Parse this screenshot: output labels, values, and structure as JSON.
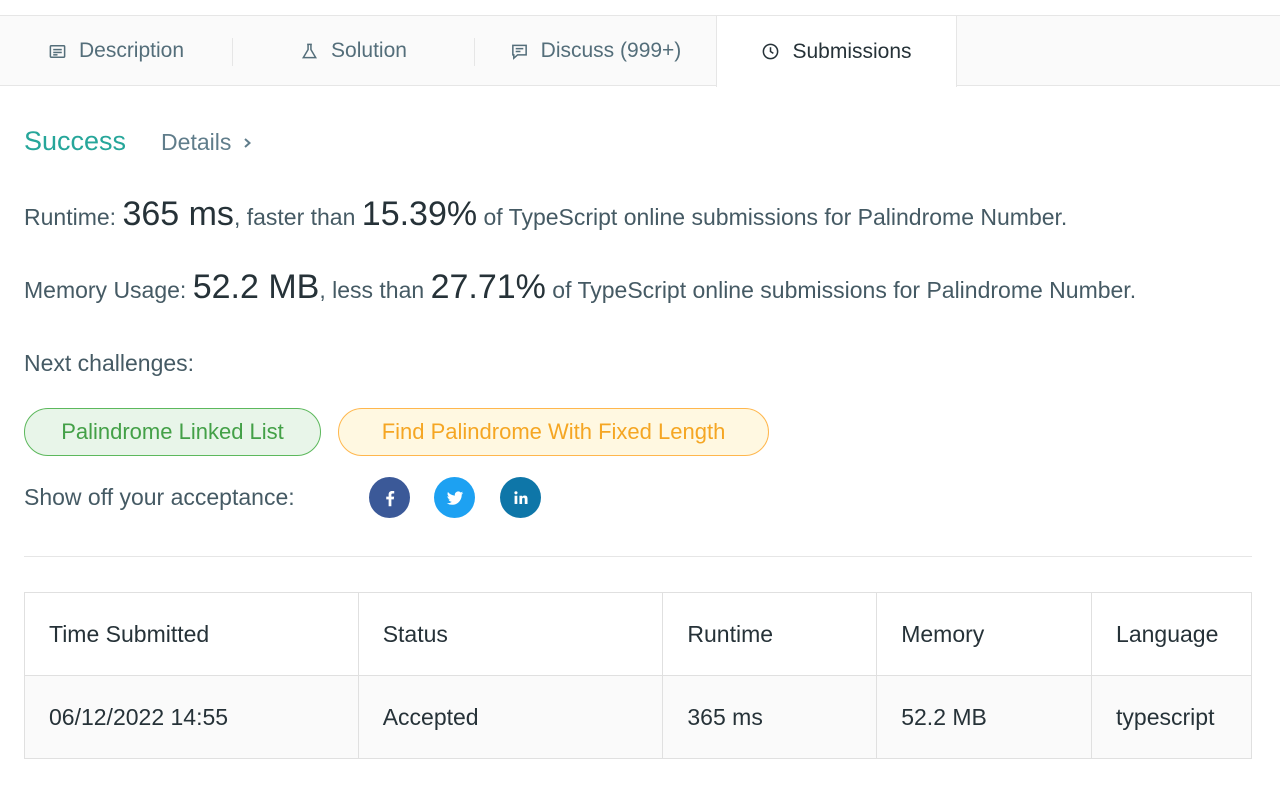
{
  "tabs": [
    {
      "label": "Description",
      "icon": "description-icon"
    },
    {
      "label": "Solution",
      "icon": "flask-icon"
    },
    {
      "label": "Discuss (999+)",
      "icon": "comment-icon"
    },
    {
      "label": "Submissions",
      "icon": "clock-icon",
      "active": true
    }
  ],
  "result": {
    "status": "Success",
    "details_label": "Details"
  },
  "runtime": {
    "label": "Runtime:",
    "value": "365 ms",
    "comparison": ", faster than",
    "percent": "15.39%",
    "suffix": "of TypeScript online submissions for Palindrome Number."
  },
  "memory": {
    "label": "Memory Usage:",
    "value": "52.2 MB",
    "comparison": ", less than",
    "percent": "27.71%",
    "suffix": "of TypeScript online submissions for Palindrome Number."
  },
  "next_challenges": {
    "label": "Next challenges:",
    "items": [
      {
        "label": "Palindrome Linked List",
        "color": "#43a047"
      },
      {
        "label": "Find Palindrome With Fixed Length",
        "color": "#f5a623"
      }
    ]
  },
  "share": {
    "label": "Show off your acceptance:",
    "icons": [
      "facebook-icon",
      "twitter-icon",
      "linkedin-icon"
    ]
  },
  "table": {
    "headers": [
      "Time Submitted",
      "Status",
      "Runtime",
      "Memory",
      "Language"
    ],
    "rows": [
      {
        "time": "06/12/2022 14:55",
        "status": "Accepted",
        "runtime": "365 ms",
        "memory": "52.2 MB",
        "language": "typescript"
      }
    ]
  },
  "colors": {
    "accent": "#26a69a",
    "facebook": "#3b5998",
    "twitter": "#1da1f2",
    "linkedin": "#0e76a8"
  }
}
